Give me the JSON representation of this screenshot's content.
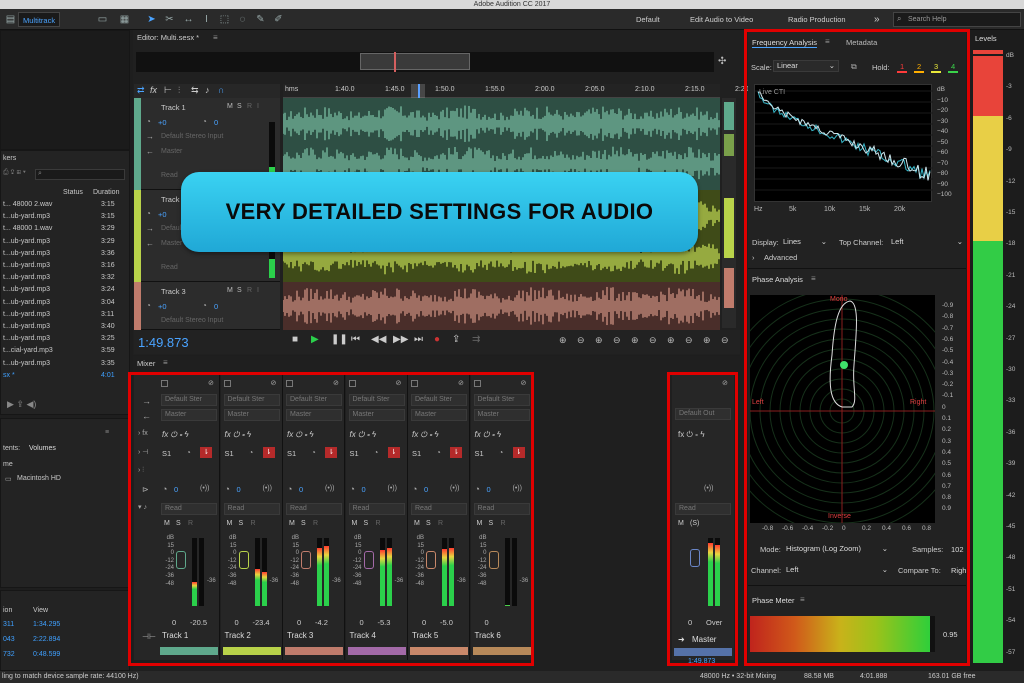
{
  "app": {
    "title": "Adobe Audition CC 2017"
  },
  "toolbar": {
    "multitrack_tab": "Multitrack",
    "workspaces": [
      "Default",
      "Edit Audio to Video",
      "Radio Production"
    ],
    "more": "»",
    "search_placeholder": "Search Help"
  },
  "left_panel": {
    "markers_label": "kers",
    "col_status": "Status",
    "col_duration": "Duration",
    "files": [
      {
        "name": "t... 48000 2.wav",
        "duration": "3:15"
      },
      {
        "name": "t...ub-yard.mp3",
        "duration": "3:15"
      },
      {
        "name": "t... 48000 1.wav",
        "duration": "3:29"
      },
      {
        "name": "t...ub-yard.mp3",
        "duration": "3:29"
      },
      {
        "name": "t...ub-yard.mp3",
        "duration": "3:36"
      },
      {
        "name": "t...ub-yard.mp3",
        "duration": "3:16"
      },
      {
        "name": "t...ub-yard.mp3",
        "duration": "3:32"
      },
      {
        "name": "t...ub-yard.mp3",
        "duration": "3:24"
      },
      {
        "name": "t...ub-yard.mp3",
        "duration": "3:04"
      },
      {
        "name": "t...ub-yard.mp3",
        "duration": "3:11"
      },
      {
        "name": "t...ub-yard.mp3",
        "duration": "3:40"
      },
      {
        "name": "t...ub-yard.mp3",
        "duration": "3:25"
      },
      {
        "name": "t...cial-yard.mp3",
        "duration": "3:59"
      },
      {
        "name": "t...ub-yard.mp3",
        "duration": "3:35"
      },
      {
        "name": "sx *",
        "duration": "4:01",
        "active": true
      }
    ],
    "contents_label": "tents:",
    "volumes_tab": "Volumes",
    "name_col": "me",
    "volume_item": "Macintosh HD",
    "sel_label": "ion",
    "view_label": "View",
    "times": [
      {
        "a": "311",
        "b": "1:34.295"
      },
      {
        "a": "043",
        "b": "2:22.894"
      },
      {
        "a": "732",
        "b": "0:48.599"
      }
    ]
  },
  "editor": {
    "title": "Editor: Multi.sesx *",
    "ruler_unit": "hms",
    "ruler_ticks": [
      "1:40.0",
      "1:45.0",
      "1:50.0",
      "1:55.0",
      "2:00.0",
      "2:05.0",
      "2:10.0",
      "2:15.0",
      "2:20.0"
    ],
    "tracks": [
      {
        "name": "Track 1",
        "vol": "+0",
        "pan": "0",
        "input": "Default Stereo Input",
        "output": "Master",
        "mode": "Read",
        "color": "#5fa98c"
      },
      {
        "name": "Track 2",
        "vol": "+0",
        "pan": "0",
        "input": "Default S",
        "output": "Master",
        "mode": "Read",
        "color": "#b9d34a"
      },
      {
        "name": "Track 3",
        "vol": "+0",
        "pan": "0",
        "input": "Default Stereo Input",
        "output": "",
        "mode": "",
        "color": "#c07c6c"
      }
    ],
    "time": "1:49.873",
    "mute": "M",
    "solo": "S",
    "rec": "R",
    "mon": "I"
  },
  "overlay_text": "VERY DETAILED SETTINGS FOR AUDIO",
  "mixer": {
    "title": "Mixer",
    "strips": [
      {
        "name": "Track 1",
        "input": "Default Ster",
        "output": "Master",
        "send": "S1",
        "pan": "0",
        "mode": "Read",
        "vol": "0",
        "peak": "-20.5",
        "meter_l": 0.35,
        "meter_r": 0.0,
        "color": "#5fa98c"
      },
      {
        "name": "Track 2",
        "input": "Default Ster",
        "output": "Master",
        "send": "S1",
        "pan": "0",
        "mode": "Read",
        "vol": "0",
        "peak": "-23.4",
        "meter_l": 0.55,
        "meter_r": 0.5,
        "color": "#b9d34a"
      },
      {
        "name": "Track 3",
        "input": "Default Ster",
        "output": "Master",
        "send": "S1",
        "pan": "0",
        "mode": "Read",
        "vol": "0",
        "peak": "-4.2",
        "meter_l": 0.85,
        "meter_r": 0.88,
        "color": "#c07c6c"
      },
      {
        "name": "Track 4",
        "input": "Default Ster",
        "output": "Master",
        "send": "S1",
        "pan": "0",
        "mode": "Read",
        "vol": "0",
        "peak": "-5.3",
        "meter_l": 0.83,
        "meter_r": 0.86,
        "color": "#a36aa8"
      },
      {
        "name": "Track 5",
        "input": "Default Ster",
        "output": "Master",
        "send": "S1",
        "pan": "0",
        "mode": "Read",
        "vol": "0",
        "peak": "-5.0",
        "meter_l": 0.84,
        "meter_r": 0.86,
        "color": "#c9886a"
      },
      {
        "name": "Track 6",
        "input": "Default Ster",
        "output": "Master",
        "send": "S1",
        "pan": "0",
        "mode": "Read",
        "vol": "0",
        "peak": "",
        "meter_l": 0.02,
        "meter_r": 0.0,
        "color": "#b88a5a"
      }
    ],
    "master": {
      "name": "Master",
      "output": "Default Out",
      "mode": "Read",
      "vol": "0",
      "peak": "Over",
      "solo_tag": "(S)",
      "time": "1:49.873",
      "color": "#5572a8"
    },
    "scale": [
      "dB",
      "15",
      "0",
      "-12",
      "-24",
      "-36",
      "-48"
    ],
    "meter_tick": "-36"
  },
  "freq": {
    "tab_active": "Frequency Analysis",
    "tab_2": "Metadata",
    "scale_label": "Scale:",
    "scale_value": "Linear",
    "hold_label": "Hold:",
    "hold_buttons": [
      "1",
      "2",
      "3",
      "4"
    ],
    "hold_colors": [
      "#ff3b3b",
      "#ffae00",
      "#e8e83a",
      "#3ad24a"
    ],
    "live_label": "Live CTI",
    "db_ticks": [
      "dB",
      "−10",
      "−20",
      "−30",
      "−40",
      "−50",
      "−60",
      "−70",
      "−80",
      "−90",
      "−100"
    ],
    "hz_ticks": [
      "Hz",
      "5k",
      "10k",
      "15k",
      "20k"
    ],
    "display_label": "Display:",
    "display_value": "Lines",
    "top_channel_label": "Top Channel:",
    "top_channel_value": "Left",
    "advanced": "Advanced"
  },
  "phase": {
    "title": "Phase Analysis",
    "mono": "Mono",
    "left": "Left",
    "right": "Right",
    "inverse": "Inverse",
    "y_ticks": [
      "-0.9",
      "-0.8",
      "-0.7",
      "-0.6",
      "-0.5",
      "-0.4",
      "-0.3",
      "-0.2",
      "-0.1",
      "0",
      "0.1",
      "0.2",
      "0.3",
      "0.4",
      "0.5",
      "0.6",
      "0.7",
      "0.8",
      "0.9"
    ],
    "x_ticks": [
      "-0.8",
      "-0.6",
      "-0.4",
      "-0.2",
      "0",
      "0.2",
      "0.4",
      "0.6",
      "0.8"
    ],
    "mode_label": "Mode:",
    "mode_value": "Histogram (Log Zoom)",
    "samples_label": "Samples:",
    "samples_value": "102",
    "channel_label": "Channel:",
    "channel_value": "Left",
    "compare_label": "Compare To:",
    "compare_value": "Righ"
  },
  "phase_meter": {
    "title": "Phase Meter",
    "value": "0.95",
    "ticks": [
      "-0.8",
      "-0.6",
      "-0.4",
      "-0.2",
      "0",
      "0.2",
      "0.4",
      "0.6",
      "0.8"
    ]
  },
  "levels": {
    "title": "Levels",
    "ticks": [
      "dB",
      "-3",
      "-6",
      "-9",
      "-12",
      "-15",
      "-18",
      "-21",
      "-24",
      "-27",
      "-30",
      "-33",
      "-36",
      "-39",
      "-42",
      "-45",
      "-48",
      "-51",
      "-54",
      "-57"
    ]
  },
  "status": {
    "left": "ling to match device sample rate: 44100 Hz)",
    "sample_rate": "48000 Hz • 32-bit Mixing",
    "mem": "88.58 MB",
    "duration": "4:01.888",
    "disk": "163.01 GB free"
  }
}
